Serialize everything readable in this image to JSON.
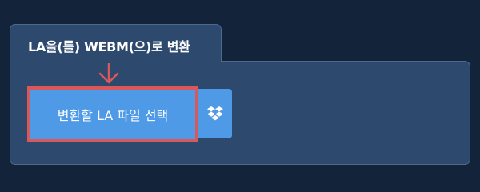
{
  "converter": {
    "title": "LA을(를) WEBM(으)로 변환",
    "choose_file_label": "변환할 LA 파일 선택",
    "dropbox_icon": "dropbox-icon",
    "pointer_icon": "arrow-down-icon"
  },
  "colors": {
    "page_background": "#13233a",
    "panel_background": "#2d4a6e",
    "button_background": "#4e9ae6",
    "highlight_border": "#d9595a"
  }
}
